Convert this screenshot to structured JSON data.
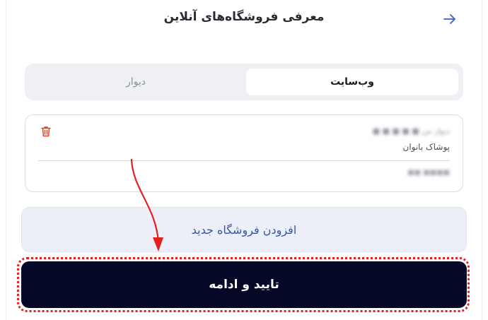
{
  "header": {
    "title": "معرفی فروشگاه‌های آنلاین",
    "back_icon": "arrow-right-icon"
  },
  "tabs": [
    {
      "label": "وب‌سایت",
      "active": true
    },
    {
      "label": "دیوار",
      "active": false
    }
  ],
  "store_card": {
    "name": "دیوار من ■ ■ ■ ■ ■",
    "category": "پوشاک بانوان",
    "link": "■■■■ ■■",
    "delete_icon": "trash-icon"
  },
  "add_store_label": "افزودن فروشگاه جدید",
  "confirm_label": "تایید و ادامه",
  "colors": {
    "accent": "#3756a8",
    "primary_button": "#050826",
    "highlight": "#e32020",
    "delete": "#d9462e"
  }
}
